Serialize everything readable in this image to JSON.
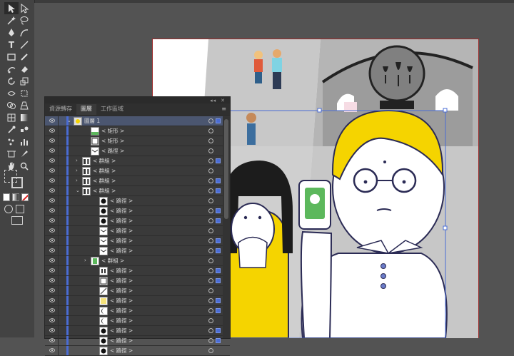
{
  "panel": {
    "tabs": [
      {
        "label": "資源轉存"
      },
      {
        "label": "圖層"
      },
      {
        "label": "工作區域"
      }
    ],
    "active_tab": 1,
    "rows": [
      {
        "label": "圖層 1",
        "indent": 0,
        "expand": "open",
        "thumb": "layer",
        "highlight": true
      },
      {
        "label": "< 矩形 >",
        "indent": 2,
        "expand": "",
        "thumb": "rect-green"
      },
      {
        "label": "< 矩形 >",
        "indent": 2,
        "expand": "",
        "thumb": "rect"
      },
      {
        "label": "< 路徑 >",
        "indent": 2,
        "expand": "",
        "thumb": "envelope"
      },
      {
        "label": "< 群組 >",
        "indent": 1,
        "expand": "closed",
        "thumb": "group"
      },
      {
        "label": "< 群組 >",
        "indent": 1,
        "expand": "closed",
        "thumb": "group"
      },
      {
        "label": "< 群組 >",
        "indent": 1,
        "expand": "closed",
        "thumb": "group"
      },
      {
        "label": "< 群組 >",
        "indent": 1,
        "expand": "open",
        "thumb": "group"
      },
      {
        "label": "< 路徑 >",
        "indent": 3,
        "expand": "",
        "thumb": "circle"
      },
      {
        "label": "< 路徑 >",
        "indent": 3,
        "expand": "",
        "thumb": "circle"
      },
      {
        "label": "< 路徑 >",
        "indent": 3,
        "expand": "",
        "thumb": "circle"
      },
      {
        "label": "< 路徑 >",
        "indent": 3,
        "expand": "",
        "thumb": "envelope"
      },
      {
        "label": "< 路徑 >",
        "indent": 3,
        "expand": "",
        "thumb": "envelope"
      },
      {
        "label": "< 路徑 >",
        "indent": 3,
        "expand": "",
        "thumb": "envelope"
      },
      {
        "label": "< 群組 >",
        "indent": 2,
        "expand": "closed",
        "thumb": "phone"
      },
      {
        "label": "< 路徑 >",
        "indent": 3,
        "expand": "",
        "thumb": "bars"
      },
      {
        "label": "< 路徑 >",
        "indent": 3,
        "expand": "",
        "thumb": "rect"
      },
      {
        "label": "< 路徑 >",
        "indent": 3,
        "expand": "",
        "thumb": "slash"
      },
      {
        "label": "< 路徑 >",
        "indent": 3,
        "expand": "",
        "thumb": "yellow"
      },
      {
        "label": "< 路徑 >",
        "indent": 3,
        "expand": "",
        "thumb": "moon"
      },
      {
        "label": "< 路徑 >",
        "indent": 3,
        "expand": "",
        "thumb": "moon"
      },
      {
        "label": "< 路徑 >",
        "indent": 3,
        "expand": "",
        "thumb": "circle"
      },
      {
        "label": "< 路徑 >",
        "indent": 3,
        "expand": "",
        "thumb": "circle"
      },
      {
        "label": "< 路徑 >",
        "indent": 3,
        "expand": "",
        "thumb": "circle"
      }
    ]
  },
  "colors": {
    "accent": "#4a6cd4",
    "shirt_yellow": "#f5d400",
    "phone_green": "#5cb85c",
    "artboard_border": "#9a2a2a"
  }
}
